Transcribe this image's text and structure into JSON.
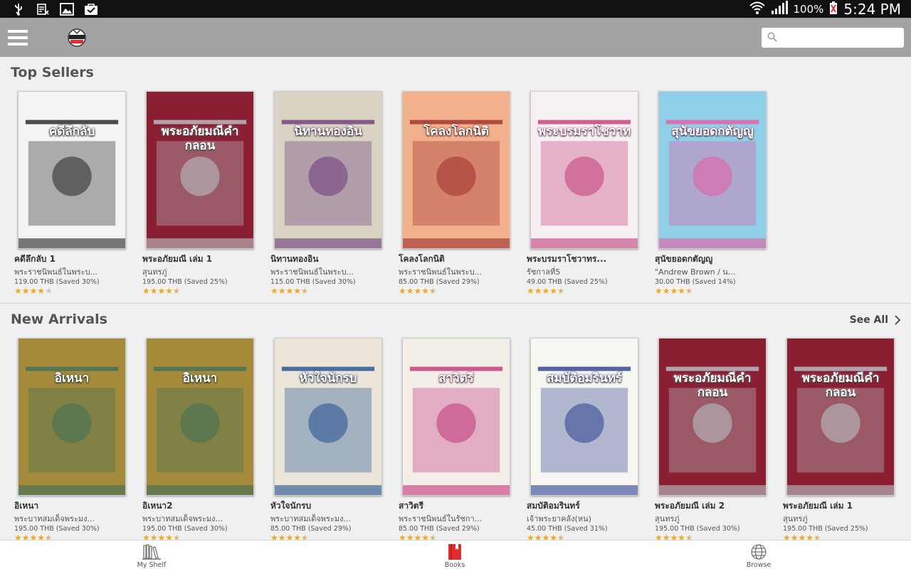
{
  "status_bar": {
    "battery": "100%",
    "time": "5:24 PM"
  },
  "app_bar": {
    "search_placeholder": ""
  },
  "colors": {
    "accent": "#e02e2e",
    "app_bar": "#a3a3a3",
    "star": "#f0a81e"
  },
  "top_sellers": {
    "title": "Top Sellers",
    "books": [
      {
        "title": "คดีลึกลับ 1",
        "author": "พระราชนิพนธ์ในพระบ...",
        "price": "119.00 THB (Saved 30%)",
        "rating": 4,
        "cover_bg": "#f4f4f4",
        "cover_accent": "#222222",
        "cover_text": "คดีลึกลับ"
      },
      {
        "title": "พระอภัยมณี เล่ม 1",
        "author": "สุนทรภู่",
        "price": "195.00 THB (Saved 25%)",
        "rating": 4.5,
        "cover_bg": "#8a1f34",
        "cover_accent": "#b9c6c8",
        "cover_text": "พระอภัยมณีคำกลอน"
      },
      {
        "title": "นิทานทองอิน",
        "author": "พระราชนิพนธ์ในพระบ...",
        "price": "115.00 THB (Saved 30%)",
        "rating": 4.5,
        "cover_bg": "#d9d3c4",
        "cover_accent": "#6b3b7a",
        "cover_text": "นิทานทองอิน"
      },
      {
        "title": "โคลงโลกนิติ",
        "author": "พระราชนิพนธ์ในพระบ...",
        "price": "85.00 THB (Saved 29%)",
        "rating": 4.5,
        "cover_bg": "#f3b08c",
        "cover_accent": "#9c2f2f",
        "cover_text": "โคลงโลกนิติ"
      },
      {
        "title": "พระบรมราโชวาทร...",
        "author": "รัชกาลที่5",
        "price": "49.00 THB (Saved 25%)",
        "rating": 4.5,
        "cover_bg": "#f6f0f2",
        "cover_accent": "#c43c7a",
        "cover_text": "พระบรมราโชวาท"
      },
      {
        "title": "สุนัขยอดกตัญญู",
        "author": "\"Andrew Brown / น...",
        "price": "30.00 THB (Saved 14%)",
        "rating": 4.5,
        "cover_bg": "#8fd0e8",
        "cover_accent": "#e85aa0",
        "cover_text": "สุนัขยอดกตัญญู"
      }
    ]
  },
  "new_arrivals": {
    "title": "New Arrivals",
    "see_all": "See All",
    "books": [
      {
        "title": "อิเหนา",
        "author": "พระบาทสมเด็จพระมง...",
        "price": "195.00 THB (Saved 30%)",
        "rating": 4.5,
        "cover_bg": "#a48a3a",
        "cover_accent": "#3f6f5a",
        "cover_text": "อิเหนา"
      },
      {
        "title": "อิเหนา2",
        "author": "พระบาทสมเด็จพระมง...",
        "price": "195.00 THB (Saved 30%)",
        "rating": 4.5,
        "cover_bg": "#a48a3a",
        "cover_accent": "#3f6f5a",
        "cover_text": "อิเหนา"
      },
      {
        "title": "หัวใจนักรบ",
        "author": "พระบาทสมเด็จพระมง...",
        "price": "85.00 THB (Saved 29%)",
        "rating": 4.5,
        "cover_bg": "#ece6da",
        "cover_accent": "#1f4f8f",
        "cover_text": "หัวใจนักรบ"
      },
      {
        "title": "สาวิตรี",
        "author": "พระราชนิพนธ์ในรัชกา...",
        "price": "85.00 THB (Saved 29%)",
        "rating": 4.5,
        "cover_bg": "#f4eee8",
        "cover_accent": "#c0357a",
        "cover_text": "สาวิตรี"
      },
      {
        "title": "สมบัติอมรินทร์",
        "author": "เจ้าพระยาคลัง(หน)",
        "price": "45.00 THB (Saved 31%)",
        "rating": 4.5,
        "cover_bg": "#f7f7f2",
        "cover_accent": "#2a3f8f",
        "cover_text": "สมบัติอมรินทร์"
      },
      {
        "title": "พระอภัยมณี เล่ม 2",
        "author": "สุนทรภู่",
        "price": "195.00 THB (Saved 30%)",
        "rating": 4.5,
        "cover_bg": "#8a1f34",
        "cover_accent": "#b9c6c8",
        "cover_text": "พระอภัยมณีคำกลอน"
      },
      {
        "title": "พระอภัยมณี เล่ม 1",
        "author": "สุนทรภู่",
        "price": "195.00 THB (Saved 25%)",
        "rating": 4.5,
        "cover_bg": "#8a1f34",
        "cover_accent": "#b9c6c8",
        "cover_text": "พระอภัยมณีคำกลอน"
      }
    ]
  },
  "bottom_nav": [
    {
      "label": "My Shelf",
      "icon": "bookshelf-icon",
      "active": false
    },
    {
      "label": "Books",
      "icon": "book-icon",
      "active": true
    },
    {
      "label": "Browse",
      "icon": "globe-icon",
      "active": false
    }
  ]
}
